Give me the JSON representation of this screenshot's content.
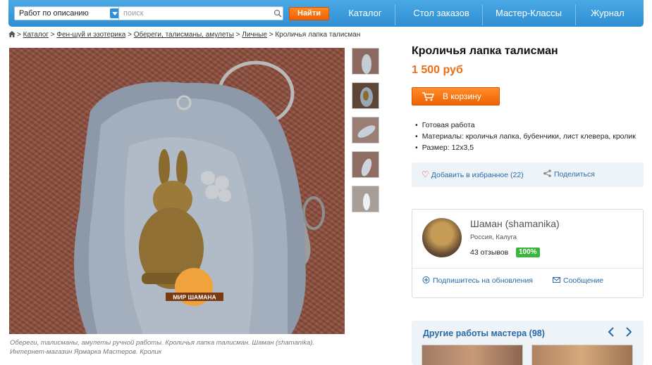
{
  "header": {
    "search_scope": "Работ по описанию",
    "search_placeholder": "поиск",
    "search_button": "Найти",
    "nav": [
      "Каталог",
      "Стол заказов",
      "Мастер-Классы",
      "Журнал"
    ]
  },
  "breadcrumb": {
    "items": [
      "Каталог",
      "Фен-шуй и эзотерика",
      "Обереги, талисманы, амулеты",
      "Личные"
    ],
    "current": "Кроличья лапка талисман",
    "separator": ">"
  },
  "image": {
    "caption": "Обереги, талисманы, амулеты ручной работы. Кроличья лапка талисман. Шаман (shamanika). Интернет-магазин Ярмарка Мастеров. Кролик",
    "watermark": "МИР ШАМАНА"
  },
  "product": {
    "title": "Кроличья лапка талисман",
    "price": "1 500 руб",
    "cart_button": "В корзину",
    "features": [
      "Готовая работа",
      "Материалы: кроличья лапка, бубенчики, лист клевера, кролик",
      "Размер: 12x3,5"
    ],
    "favorite_label": "Добавить в избранное (22)",
    "share_label": "Поделиться"
  },
  "seller": {
    "name": "Шаман (shamanika)",
    "location": "Россия, Калуга",
    "reviews": "43 отзывов",
    "rating": "100%",
    "subscribe_label": "Подпишитесь на обновления",
    "message_label": "Сообщение"
  },
  "other_works": {
    "title": "Другие работы мастера (98)"
  },
  "colors": {
    "topbar": "#3a9ad9",
    "accent_orange": "#f06200",
    "price": "#ee6f12",
    "link": "#2a6aa8",
    "rating": "#3cb53c"
  },
  "icons": [
    "home-icon",
    "search-icon",
    "cart-icon",
    "heart-icon",
    "share-icon",
    "plus-icon",
    "envelope-icon",
    "arrow-left-icon",
    "arrow-right-icon"
  ]
}
